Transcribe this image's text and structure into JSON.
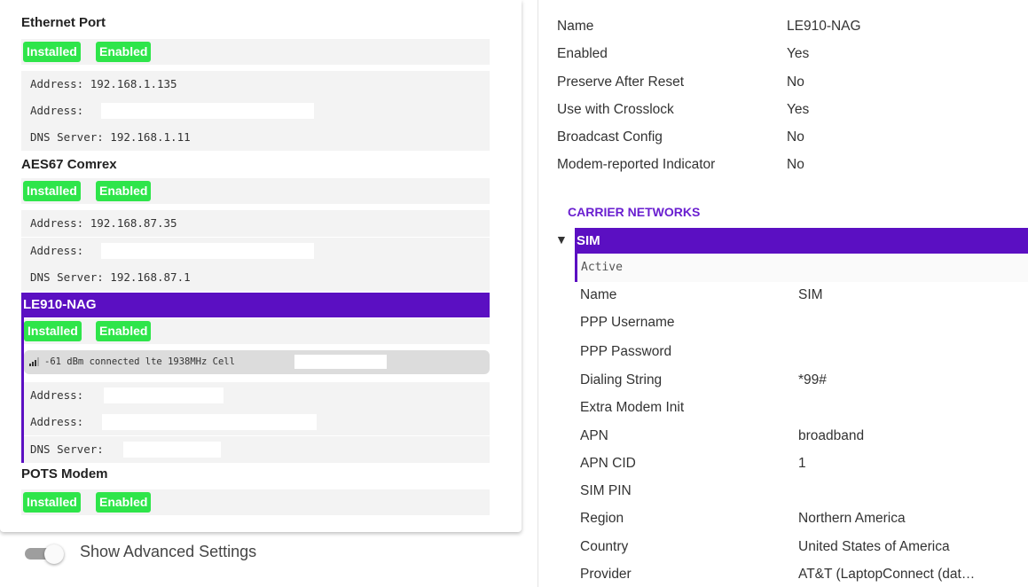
{
  "interfaces": [
    {
      "name": "Ethernet Port",
      "badges": [
        "Installed",
        "Enabled"
      ],
      "rows": [
        "Address: 192.168.1.135",
        "Address:",
        "DNS Server: 192.168.1.11"
      ]
    },
    {
      "name": "AES67 Comrex",
      "badges": [
        "Installed",
        "Enabled"
      ],
      "rows": [
        "Address: 192.168.87.35",
        "Address:",
        "DNS Server: 192.168.87.1"
      ]
    },
    {
      "name": "LE910-NAG",
      "badges": [
        "Installed",
        "Enabled"
      ],
      "cell_status": "-61 dBm connected lte 1938MHz Cell",
      "rows": [
        "Address:",
        "Address:",
        "DNS Server:"
      ]
    },
    {
      "name": "POTS Modem",
      "badges": [
        "Installed",
        "Enabled"
      ]
    }
  ],
  "advanced_toggle": {
    "label": "Show Advanced Settings",
    "on": false
  },
  "details": [
    {
      "key": "Name",
      "value": "LE910-NAG"
    },
    {
      "key": "Enabled",
      "value": "Yes"
    },
    {
      "key": "Preserve After Reset",
      "value": "No"
    },
    {
      "key": "Use with Crosslock",
      "value": "Yes"
    },
    {
      "key": "Broadcast Config",
      "value": "No"
    },
    {
      "key": "Modem-reported Indicator",
      "value": "No"
    }
  ],
  "carrier_networks": {
    "title": "CARRIER NETWORKS",
    "sim": {
      "name": "SIM",
      "status": "Active",
      "fields": [
        {
          "key": "Name",
          "value": "SIM"
        },
        {
          "key": "PPP Username",
          "value": ""
        },
        {
          "key": "PPP Password",
          "value": ""
        },
        {
          "key": "Dialing String",
          "value": "*99#"
        },
        {
          "key": "Extra Modem Init",
          "value": ""
        },
        {
          "key": "APN",
          "value": "broadband"
        },
        {
          "key": "APN CID",
          "value": "1"
        },
        {
          "key": "SIM PIN",
          "value": ""
        },
        {
          "key": "Region",
          "value": "Northern America"
        },
        {
          "key": "Country",
          "value": "United States of America"
        },
        {
          "key": "Provider",
          "value": "AT&T (LaptopConnect (dat…"
        }
      ]
    }
  },
  "colors": {
    "accent": "#5b0fc2",
    "badge": "#2ee54a",
    "section_title": "#6a1fd0"
  }
}
